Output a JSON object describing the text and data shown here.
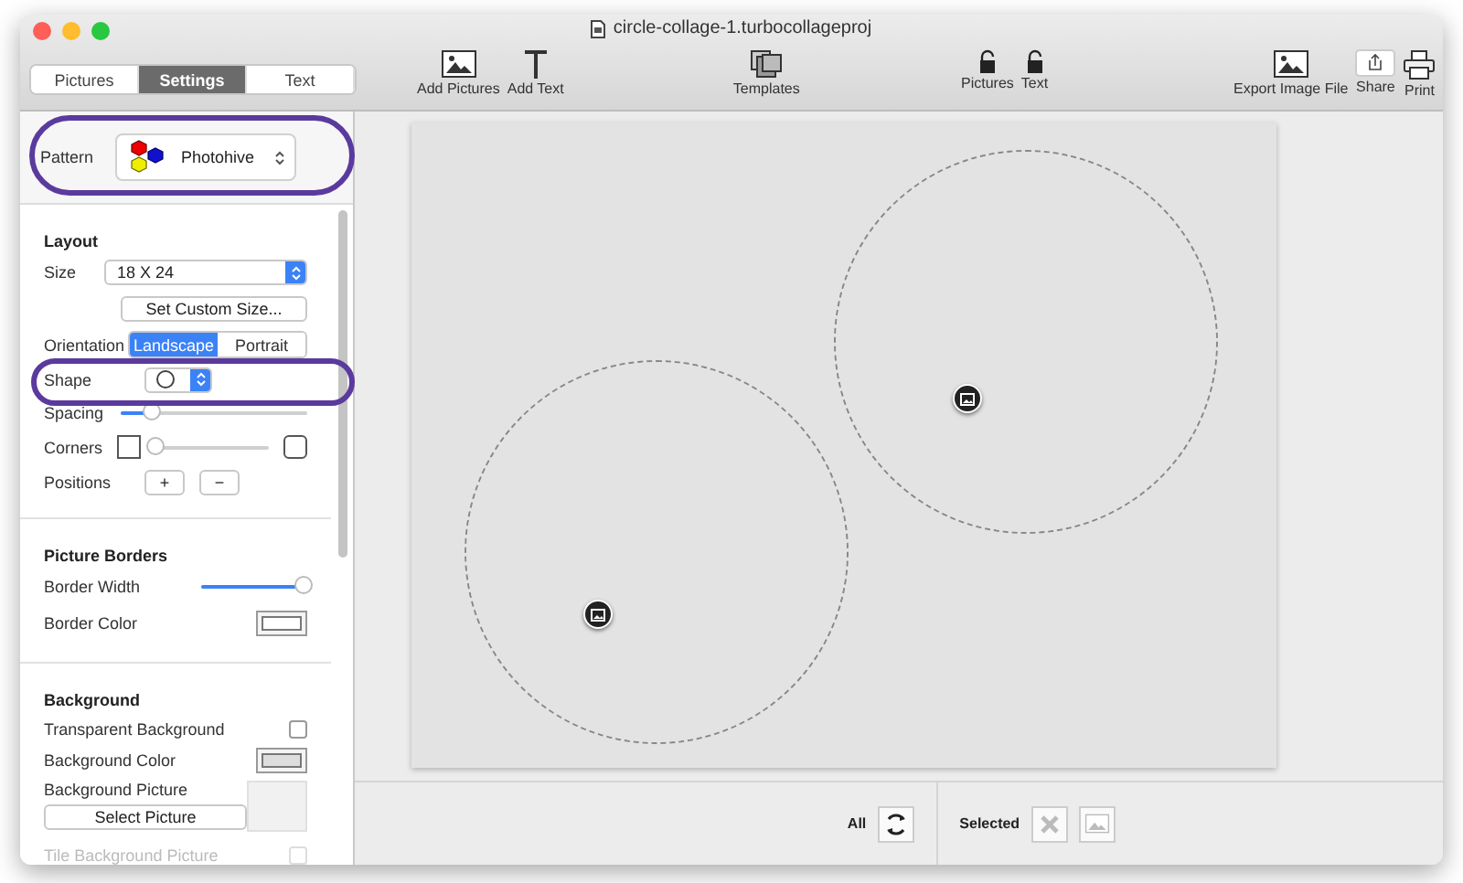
{
  "window": {
    "title": "circle-collage-1.turbocollageproj"
  },
  "mode_tabs": [
    {
      "label": "Pictures",
      "selected": false
    },
    {
      "label": "Settings",
      "selected": true
    },
    {
      "label": "Text",
      "selected": false
    }
  ],
  "toolbar": {
    "add_pictures": "Add Pictures",
    "add_text": "Add Text",
    "templates": "Templates",
    "lock_pictures": "Pictures",
    "lock_text": "Text",
    "export": "Export Image File",
    "share": "Share",
    "print": "Print"
  },
  "pattern": {
    "label": "Pattern",
    "value": "Photohive"
  },
  "layout": {
    "heading": "Layout",
    "size_label": "Size",
    "size_value": "18 X 24",
    "custom_size": "Set Custom Size...",
    "orientation_label": "Orientation",
    "orientations": [
      {
        "label": "Landscape",
        "selected": true
      },
      {
        "label": "Portrait",
        "selected": false
      }
    ],
    "shape_label": "Shape",
    "spacing_label": "Spacing",
    "spacing": {
      "level": 0.17
    },
    "corners_label": "Corners",
    "corners": {
      "level": 0.0
    },
    "positions_label": "Positions",
    "add": "+",
    "remove": "−"
  },
  "borders": {
    "heading": "Picture Borders",
    "width_label": "Border Width",
    "width": {
      "level": 0.97
    },
    "color_label": "Border Color"
  },
  "background": {
    "heading": "Background",
    "transparent_label": "Transparent Background",
    "transparent": {
      "checked": false
    },
    "color_label": "Background Color",
    "picture_label": "Background Picture",
    "select_picture": "Select Picture",
    "tile_label": "Tile Background Picture",
    "tile": {
      "checked": false,
      "disabled": true
    }
  },
  "bottom_bar": {
    "all": "All",
    "selected": "Selected"
  }
}
